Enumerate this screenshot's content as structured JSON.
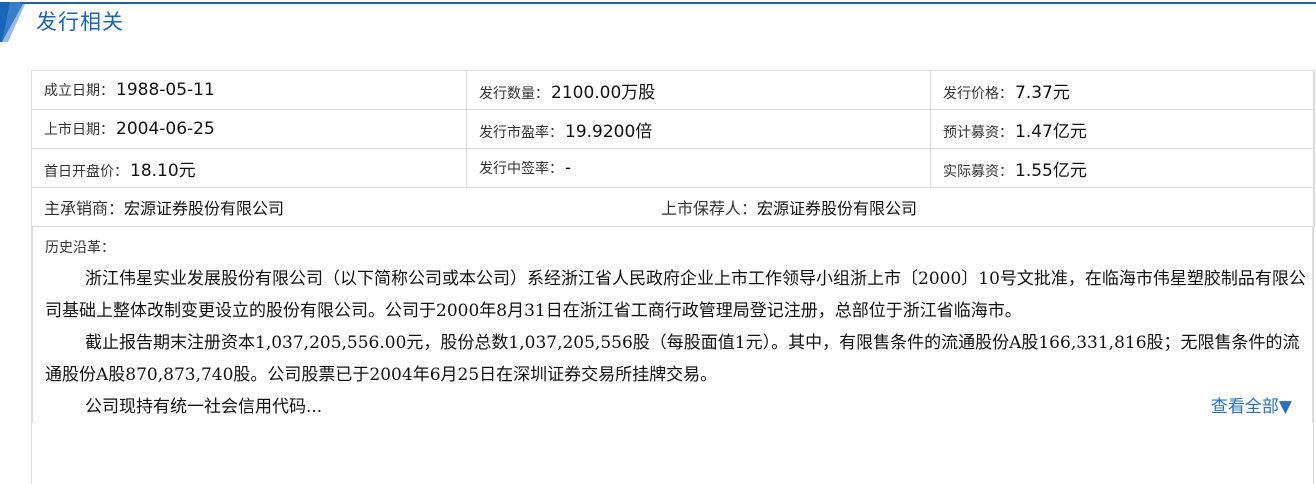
{
  "section": {
    "title": "发行相关"
  },
  "colors": {
    "accent": "#1a65b8",
    "link": "#2a6fc1",
    "border": "#dcdcdc"
  },
  "grid": [
    [
      {
        "label": "成立日期：",
        "value": "1988-05-11"
      },
      {
        "label": "发行数量：",
        "value": "2100.00万股"
      },
      {
        "label": "发行价格：",
        "value": "7.37元"
      }
    ],
    [
      {
        "label": "上市日期：",
        "value": "2004-06-25"
      },
      {
        "label": "发行市盈率：",
        "value": "19.9200倍"
      },
      {
        "label": "预计募资：",
        "value": "1.47亿元"
      }
    ],
    [
      {
        "label": "首日开盘价：",
        "value": "18.10元"
      },
      {
        "label": "发行中签率：",
        "value": "-"
      },
      {
        "label": "实际募资：",
        "value": "1.55亿元"
      }
    ]
  ],
  "underwriter": {
    "label": "主承销商：",
    "value": "宏源证券股份有限公司"
  },
  "sponsor": {
    "label": "上市保荐人：",
    "value": "宏源证券股份有限公司"
  },
  "history": {
    "title": "历史沿革：",
    "paragraphs": [
      "浙江伟星实业发展股份有限公司（以下简称公司或本公司）系经浙江省人民政府企业上市工作领导小组浙上市〔2000〕10号文批准，在临海市伟星塑胶制品有限公司基础上整体改制变更设立的股份有限公司。公司于2000年8月31日在浙江省工商行政管理局登记注册，总部位于浙江省临海市。",
      "截止报告期末注册资本1,037,205,556.00元，股份总数1,037,205,556股（每股面值1元）。其中，有限售条件的流通股份A股166,331,816股；无限售条件的流通股份A股870,873,740股。公司股票已于2004年6月25日在深圳证券交易所挂牌交易。"
    ],
    "truncated": "公司现持有统一社会信用代码...",
    "view_all": "查看全部▼"
  }
}
